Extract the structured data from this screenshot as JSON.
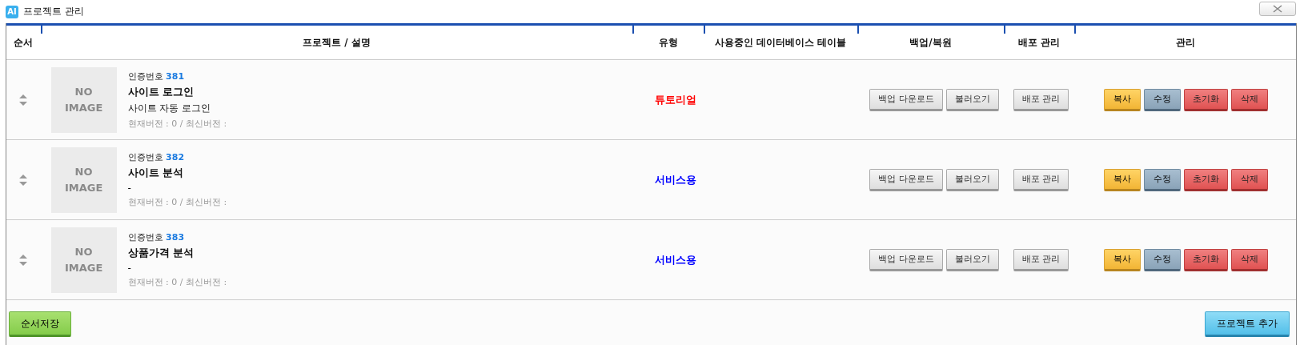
{
  "window": {
    "title": "프로젝트 관리",
    "logo": "AI"
  },
  "table": {
    "columns": [
      "순서",
      "프로젝트 / 설명",
      "유형",
      "사용중인 데이터베이스 테이블",
      "백업/복원",
      "배포 관리",
      "관리"
    ],
    "rows": [
      {
        "image_text": "NO IMAGE",
        "cert_label": "인증번호",
        "cert_no": "381",
        "name": "사이트 로그인",
        "desc": "사이트 자동 로그인",
        "version": "현재버전 : 0 / 최신버전 :",
        "type": "튜토리얼",
        "color": "#ff0000",
        "backup": [
          {
            "label": "백업 다운로드",
            "kind": "gray"
          },
          {
            "label": "불러오기",
            "kind": "gray"
          }
        ],
        "deploy": [
          {
            "label": "배포 관리",
            "kind": "gray"
          }
        ],
        "manage": [
          {
            "label": "복사",
            "kind": "yellow"
          },
          {
            "label": "수정",
            "kind": "steel"
          },
          {
            "label": "초기화",
            "kind": "red"
          },
          {
            "label": "삭제",
            "kind": "red"
          }
        ]
      },
      {
        "image_text": "NO IMAGE",
        "cert_label": "인증번호",
        "cert_no": "382",
        "name": "사이트 분석",
        "desc": "-",
        "version": "현재버전 : 0 / 최신버전 :",
        "type": "서비스용",
        "color": "#0000ff",
        "backup": [
          {
            "label": "백업 다운로드",
            "kind": "gray"
          },
          {
            "label": "불러오기",
            "kind": "gray"
          }
        ],
        "deploy": [
          {
            "label": "배포 관리",
            "kind": "gray"
          }
        ],
        "manage": [
          {
            "label": "복사",
            "kind": "yellow"
          },
          {
            "label": "수정",
            "kind": "steel"
          },
          {
            "label": "초기화",
            "kind": "red"
          },
          {
            "label": "삭제",
            "kind": "red"
          }
        ]
      },
      {
        "image_text": "NO IMAGE",
        "cert_label": "인증번호",
        "cert_no": "383",
        "name": "상품가격 분석",
        "desc": "-",
        "version": "현재버전 : 0 / 최신버전 :",
        "type": "서비스용",
        "color": "#0000ff",
        "backup": [
          {
            "label": "백업 다운로드",
            "kind": "gray"
          },
          {
            "label": "불러오기",
            "kind": "gray"
          }
        ],
        "deploy": [
          {
            "label": "배포 관리",
            "kind": "gray"
          }
        ],
        "manage": [
          {
            "label": "복사",
            "kind": "yellow"
          },
          {
            "label": "수정",
            "kind": "steel"
          },
          {
            "label": "초기화",
            "kind": "red"
          },
          {
            "label": "삭제",
            "kind": "red"
          }
        ]
      }
    ]
  },
  "footer": {
    "left_button": "순서저장",
    "right_button": "프로젝트 추가"
  }
}
